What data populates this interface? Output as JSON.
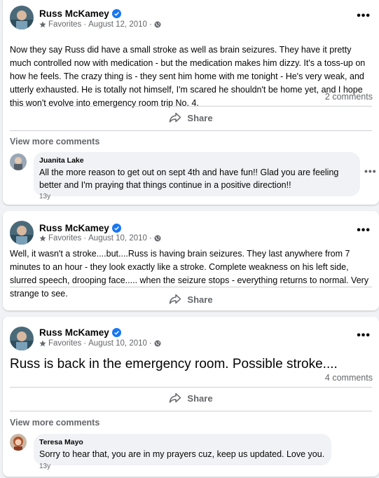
{
  "post1": {
    "author": "Russ McKamey",
    "audience": "Favorites",
    "date": "August 12, 2010",
    "text": "Now they say Russ did have a small stroke as well as brain seizures.  They have it pretty much controlled now with medication - but the medication makes him dizzy.  It's a toss-up on how he feels.  The crazy thing is - they sent him home with me tonight - He's very weak, and utterly exhausted.  He is totally not himself, I'm scared he shouldn't be home yet, and I hope this won't evolve into emergency room trip No. 4.",
    "comment_count": "2 comments",
    "share_label": "Share",
    "view_more": "View more comments",
    "comment": {
      "name": "Juanita Lake",
      "text": "All the more reason to get out on sept 4th and have fun!! Glad you are feeling better and I'm praying that things continue in a positive direction!!",
      "time": "13y"
    }
  },
  "post2": {
    "author": "Russ McKamey",
    "audience": "Favorites",
    "date": "August 10, 2010",
    "text": "Well, it wasn't a stroke....but....Russ is having brain seizures.  They last anywhere from 7 minutes to an hour - they look exactly like a stroke.  Complete weakness on his left side, slurred speech, drooping face..... when the seizure stops - everything returns to normal.  Very strange to see.",
    "share_label": "Share"
  },
  "post3": {
    "author": "Russ McKamey",
    "audience": "Favorites",
    "date": "August 10, 2010",
    "text": "Russ is back in the emergency room. Possible stroke....",
    "comment_count": "4 comments",
    "share_label": "Share",
    "view_more": "View more comments",
    "comment": {
      "name": "Teresa Mayo",
      "text": "Sorry to hear that, you are in my prayers cuz, keep us updated. Love you.",
      "time": "13y"
    }
  },
  "separator": "·",
  "more_glyph": "•••",
  "colors": {
    "verified": "#1877f2",
    "secondary_text": "#65676b",
    "comment_bubble": "#f0f2f5"
  },
  "icons": {
    "audience": "star-icon",
    "privacy": "globe-icon",
    "verified": "verified-badge-icon",
    "share": "share-arrow-icon",
    "more": "more-options-icon"
  }
}
